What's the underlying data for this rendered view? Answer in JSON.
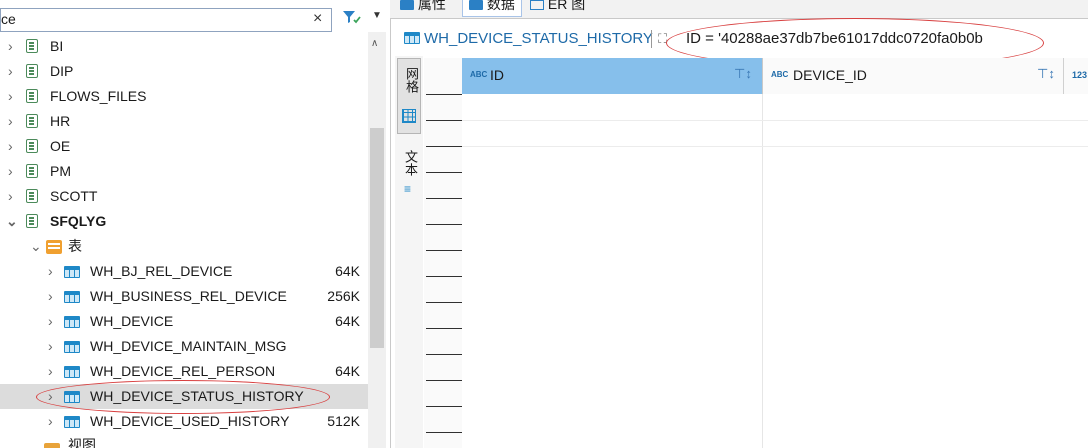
{
  "filter": {
    "value": "ce",
    "clear_label": "×"
  },
  "tree": {
    "schemas": [
      "BI",
      "DIP",
      "FLOWS_FILES",
      "HR",
      "OE",
      "PM",
      "SCOTT"
    ],
    "open_schema": "SFQLYG",
    "tables_folder": "表",
    "tables": [
      {
        "name": "WH_BJ_REL_DEVICE",
        "size": "64K"
      },
      {
        "name": "WH_BUSINESS_REL_DEVICE",
        "size": "256K"
      },
      {
        "name": "WH_DEVICE",
        "size": "64K"
      },
      {
        "name": "WH_DEVICE_MAINTAIN_MSG",
        "size": ""
      },
      {
        "name": "WH_DEVICE_REL_PERSON",
        "size": "64K"
      },
      {
        "name": "WH_DEVICE_STATUS_HISTORY",
        "size": ""
      },
      {
        "name": "WH_DEVICE_USED_HISTORY",
        "size": "512K"
      }
    ],
    "views_folder": "视图"
  },
  "tabs": {
    "properties": "属性",
    "data": "数据",
    "er": "ER 图"
  },
  "query": {
    "table_name": "WH_DEVICE_STATUS_HISTORY",
    "where_clause": "ID = '40288ae37db7be61017ddc0720fa0b0b"
  },
  "side_tabs": {
    "grid": "网格",
    "text": "文本"
  },
  "grid": {
    "columns": [
      {
        "type_badge": "ABC",
        "name": "ID"
      },
      {
        "type_badge": "ABC",
        "name": "DEVICE_ID"
      },
      {
        "type_badge": "123",
        "name": ""
      }
    ]
  },
  "colors": {
    "accent": "#1e88c7",
    "selected_column": "#86bfeb",
    "annotation": "#d84040"
  }
}
